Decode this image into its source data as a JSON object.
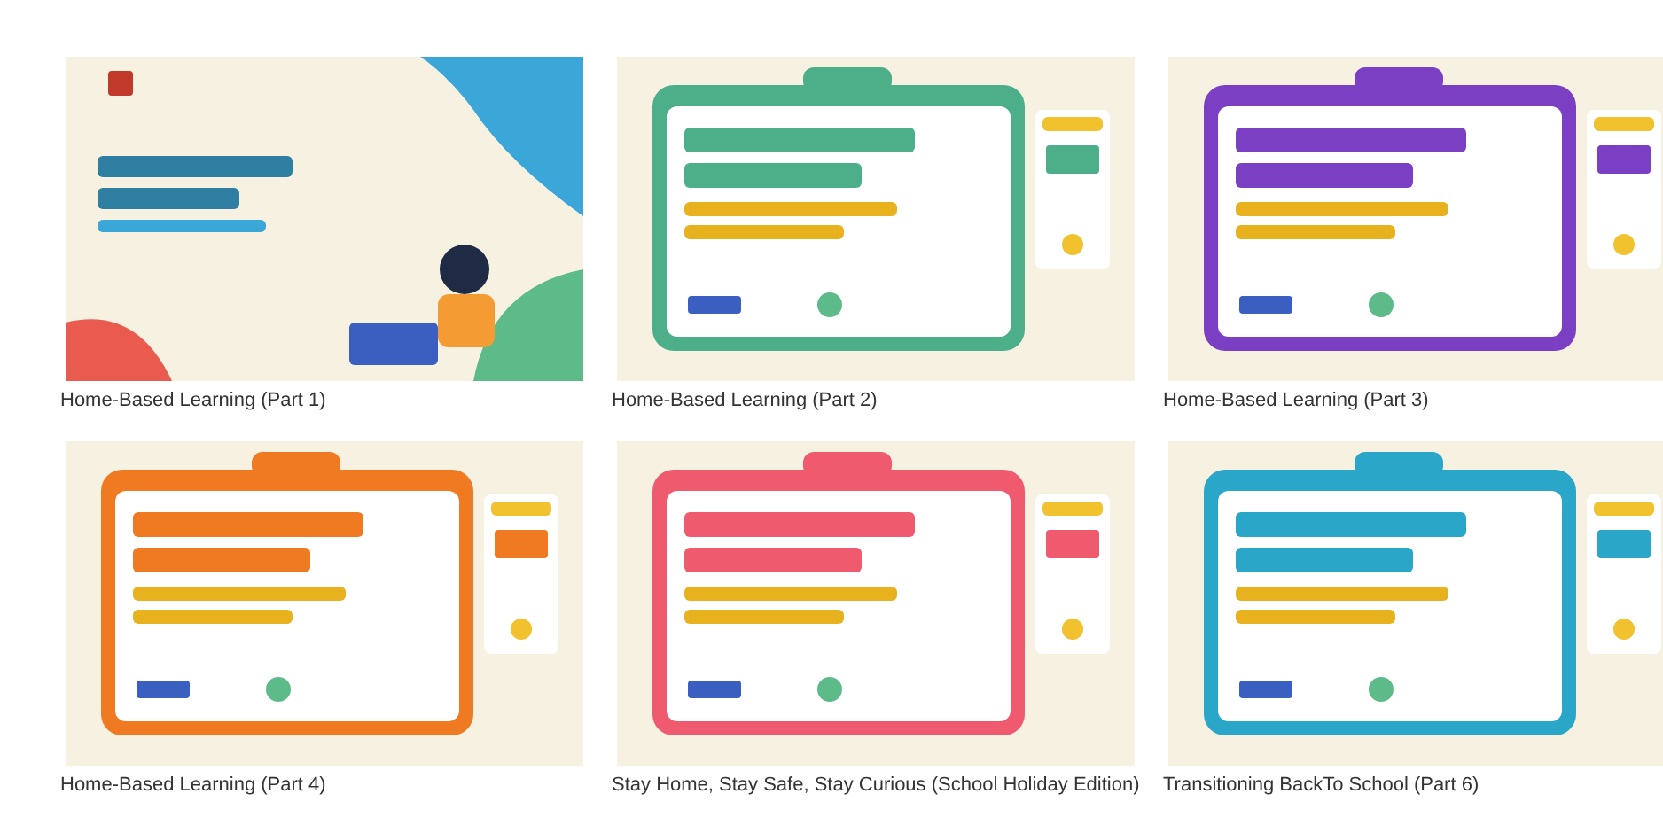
{
  "gallery": [
    {
      "caption": "Home-Based Learning (Part 1)"
    },
    {
      "caption": "Home-Based Learning (Part 2)"
    },
    {
      "caption": "Home-Based Learning (Part 3)"
    },
    {
      "caption": "Home-Based Learning (Part 4)"
    },
    {
      "caption": "Stay Home, Stay Safe, Stay Curious (School Holiday Edition)"
    },
    {
      "caption": "Transitioning BackTo School (Part 6)"
    }
  ]
}
